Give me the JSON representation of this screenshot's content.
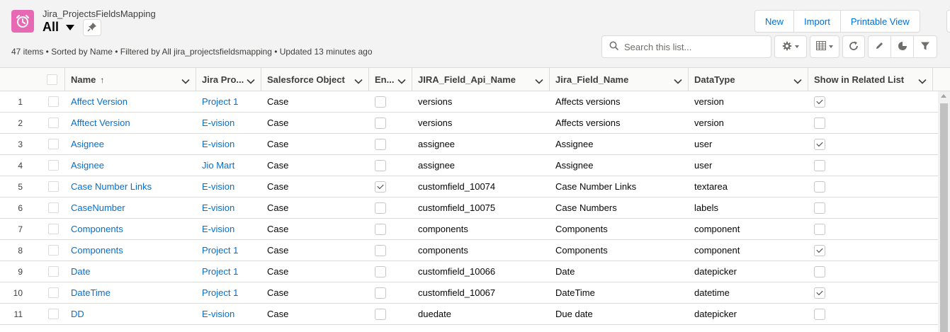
{
  "header": {
    "object_name": "Jira_ProjectsFieldsMapping",
    "list_view": "All",
    "meta": "47 items • Sorted by Name • Filtered by All jira_projectsfieldsmapping • Updated 13 minutes ago",
    "buttons": {
      "new": "New",
      "import": "Import",
      "printable": "Printable View"
    },
    "search": {
      "placeholder": "Search this list..."
    }
  },
  "icons": [
    "alarm-clock-icon",
    "pin-icon",
    "search-icon",
    "gear-icon",
    "table-icon",
    "refresh-icon",
    "pencil-icon",
    "chart-icon",
    "filter-icon",
    "chevron-down-icon",
    "sort-up-icon"
  ],
  "colors": {
    "object_icon": "#e769b4",
    "link": "#0070d2"
  },
  "columns": [
    {
      "label": "Name",
      "sorted": "asc"
    },
    {
      "label": "Jira Pro..."
    },
    {
      "label": "Salesforce Object"
    },
    {
      "label": "En..."
    },
    {
      "label": "JIRA_Field_Api_Name"
    },
    {
      "label": "Jira_Field_Name"
    },
    {
      "label": "DataType"
    },
    {
      "label": "Show in Related List"
    }
  ],
  "rows": [
    {
      "num": "1",
      "name": "Affect Version",
      "project": "Project 1",
      "sf_object": "Case",
      "enabled": false,
      "api_name": "versions",
      "field_name": "Affects versions",
      "datatype": "version",
      "related": true
    },
    {
      "num": "2",
      "name": "Afftect Version",
      "project": "E-vision",
      "sf_object": "Case",
      "enabled": false,
      "api_name": "versions",
      "field_name": "Affects versions",
      "datatype": "version",
      "related": false
    },
    {
      "num": "3",
      "name": "Asignee",
      "project": "E-vision",
      "sf_object": "Case",
      "enabled": false,
      "api_name": "assignee",
      "field_name": "Assignee",
      "datatype": "user",
      "related": true
    },
    {
      "num": "4",
      "name": "Asignee",
      "project": "Jio Mart",
      "sf_object": "Case",
      "enabled": false,
      "api_name": "assignee",
      "field_name": "Assignee",
      "datatype": "user",
      "related": false
    },
    {
      "num": "5",
      "name": "Case Number Links",
      "project": "E-vision",
      "sf_object": "Case",
      "enabled": true,
      "api_name": "customfield_10074",
      "field_name": "Case Number Links",
      "datatype": "textarea",
      "related": false
    },
    {
      "num": "6",
      "name": "CaseNumber",
      "project": "E-vision",
      "sf_object": "Case",
      "enabled": false,
      "api_name": "customfield_10075",
      "field_name": "Case Numbers",
      "datatype": "labels",
      "related": false
    },
    {
      "num": "7",
      "name": "Components",
      "project": "E-vision",
      "sf_object": "Case",
      "enabled": false,
      "api_name": "components",
      "field_name": "Components",
      "datatype": "component",
      "related": false
    },
    {
      "num": "8",
      "name": "Components",
      "project": "Project 1",
      "sf_object": "Case",
      "enabled": false,
      "api_name": "components",
      "field_name": "Components",
      "datatype": "component",
      "related": true
    },
    {
      "num": "9",
      "name": "Date",
      "project": "Project 1",
      "sf_object": "Case",
      "enabled": false,
      "api_name": "customfield_10066",
      "field_name": "Date",
      "datatype": "datepicker",
      "related": false
    },
    {
      "num": "10",
      "name": "DateTime",
      "project": "Project 1",
      "sf_object": "Case",
      "enabled": false,
      "api_name": "customfield_10067",
      "field_name": "DateTime",
      "datatype": "datetime",
      "related": true
    },
    {
      "num": "11",
      "name": "DD",
      "project": "E-vision",
      "sf_object": "Case",
      "enabled": false,
      "api_name": "duedate",
      "field_name": "Due date",
      "datatype": "datepicker",
      "related": false
    }
  ]
}
